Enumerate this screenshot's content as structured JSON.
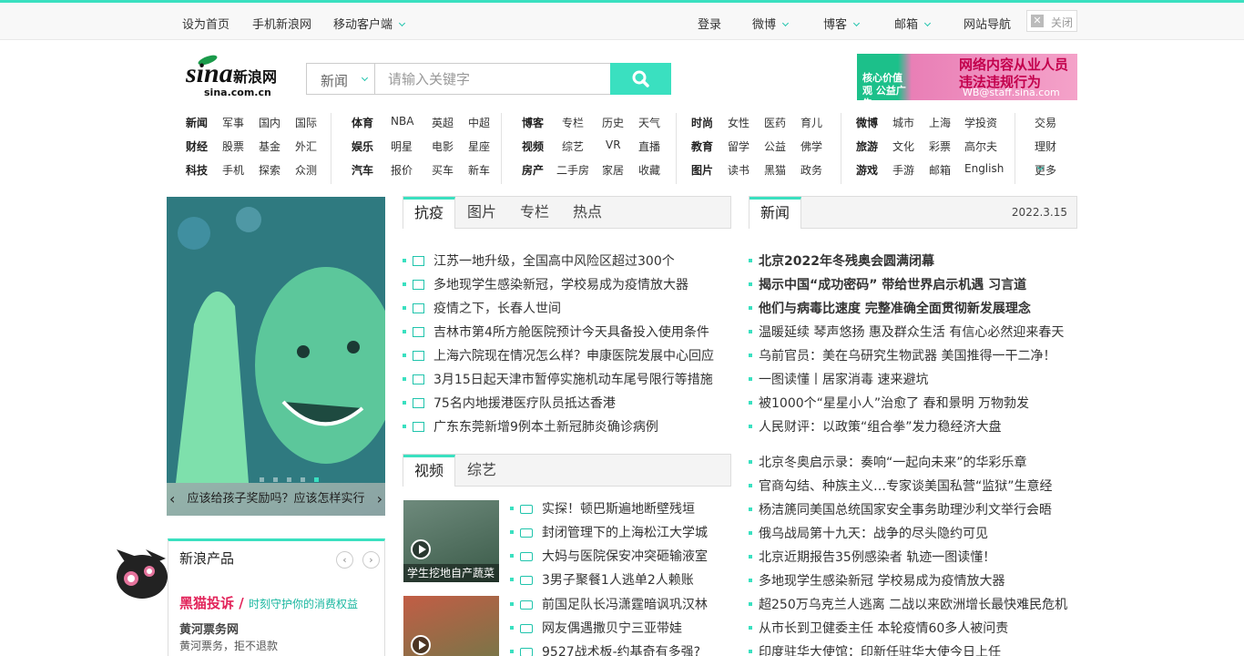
{
  "topbar": {
    "set_home": "设为首页",
    "mobile_sina": "手机新浪网",
    "mobile_client": "移动客户端",
    "login": "登录",
    "weibo": "微博",
    "blog": "博客",
    "mail": "邮箱",
    "site_nav": "网站导航",
    "close": "关闭"
  },
  "logo": {
    "text": "sina",
    "cn": "新浪网",
    "url_text": "sina.com.cn"
  },
  "search": {
    "category": "新闻",
    "placeholder": "请输入关键字"
  },
  "ad": {
    "left": "核心价值观 公益广告",
    "main": "网络内容从业人员 违法违规行为",
    "email": "WB@staff.sina.com"
  },
  "nav": {
    "groups": [
      {
        "rows": [
          [
            "新闻",
            "军事",
            "国内",
            "国际"
          ],
          [
            "财经",
            "股票",
            "基金",
            "外汇"
          ],
          [
            "科技",
            "手机",
            "探索",
            "众测"
          ]
        ]
      },
      {
        "rows": [
          [
            "体育",
            "NBA",
            "英超",
            "中超"
          ],
          [
            "娱乐",
            "明星",
            "电影",
            "星座"
          ],
          [
            "汽车",
            "报价",
            "买车",
            "新车"
          ]
        ]
      },
      {
        "rows": [
          [
            "博客",
            "专栏",
            "历史",
            "天气"
          ],
          [
            "视频",
            "综艺",
            "VR",
            "直播"
          ],
          [
            "房产",
            "二手房",
            "家居",
            "收藏"
          ]
        ]
      },
      {
        "rows": [
          [
            "时尚",
            "女性",
            "医药",
            "育儿"
          ],
          [
            "教育",
            "留学",
            "公益",
            "佛学"
          ],
          [
            "图片",
            "读书",
            "黑猫",
            "政务"
          ]
        ]
      },
      {
        "rows": [
          [
            "微博",
            "城市",
            "上海",
            "学投资"
          ],
          [
            "旅游",
            "文化",
            "彩票",
            "高尔夫"
          ],
          [
            "游戏",
            "手游",
            "邮箱",
            "English"
          ]
        ]
      },
      {
        "rows": [
          [
            "交易"
          ],
          [
            "理财"
          ],
          [
            "更多"
          ]
        ]
      }
    ]
  },
  "carousel": {
    "caption": "应该给孩子奖励吗？应该怎样实行"
  },
  "products": {
    "title": "新浪产品",
    "heimao": "黑猫投诉",
    "heimao_slogan": "时刻守护你的消费权益",
    "huanghe": "黄河票务网",
    "huanghe_desc": "黄河票务，拒不退款"
  },
  "epidemic": {
    "tabs": [
      "抗疫",
      "图片",
      "专栏",
      "热点"
    ],
    "items": [
      "江苏一地升级，全国高中风险区超过300个",
      "多地现学生感染新冠，学校易成为疫情放大器",
      "疫情之下，长春人世间",
      "吉林市第4所方舱医院预计今天具备投入使用条件",
      "上海六院现在情况怎么样？申康医院发展中心回应",
      "3月15日起天津市暂停实施机动车尾号限行等措施",
      "75名内地援港医疗队员抵达香港",
      "广东东莞新增9例本土新冠肺炎确诊病例"
    ]
  },
  "video": {
    "tabs": [
      "视频",
      "综艺"
    ],
    "thumb_caption": "学生挖地自产蔬菜",
    "items": [
      "实探！顿巴斯遍地断壁残垣",
      "封闭管理下的上海松江大学城",
      "大妈与医院保安冲突砸输液室",
      "3男子聚餐1人逃单2人赖账",
      "前国足队长冯潇霆暗讽巩汉林",
      "网友偶遇撒贝宁三亚带娃",
      "9527战术板-约基奇有多强?"
    ]
  },
  "news": {
    "tab": "新闻",
    "date": "2022.3.15",
    "bold_items": [
      "北京2022年冬残奥会圆满闭幕",
      "揭示中国“成功密码” 带给世界启示机遇 习言道",
      "他们与病毒比速度 完整准确全面贯彻新发展理念"
    ],
    "items": [
      "温暖延续 琴声悠扬 惠及群众生活 有信心必然迎来春天",
      "乌前官员：美在乌研究生物武器 美国推得一干二净！",
      "一图读懂丨居家消毒 速来避坑",
      "被1000个“星星小人”治愈了 春和景明 万物勃发",
      "人民财评：以政策“组合拳”发力稳经济大盘"
    ],
    "items2": [
      "北京冬奥启示录：奏响“一起向未来”的华彩乐章",
      "官商勾结、种族主义…专家谈美国私营“监狱”生意经",
      "杨洁篪同美国总统国家安全事务助理沙利文举行会晤",
      "俄乌战局第十九天：战争的尽头隐约可见",
      "北京近期报告35例感染者 轨迹一图读懂！",
      "多地现学生感染新冠 学校易成为疫情放大器",
      "超250万乌克兰人逃离 二战以来欧洲增长最快难民危机",
      "从市长到卫健委主任 本轮疫情60多人被问责",
      "印度驻华大使馆：印新任驻华大使今日上任"
    ]
  },
  "colors": {
    "accent": "#3ae0c0",
    "accent_dark": "#1fc4ac",
    "link_red": "#e2245a"
  }
}
